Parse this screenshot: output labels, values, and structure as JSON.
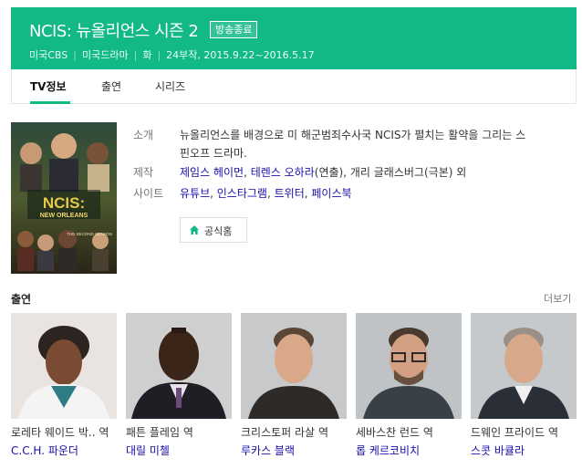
{
  "header": {
    "title": "NCIS: 뉴올리언스 시즌 2",
    "badge": "방송종료",
    "meta": [
      "미국CBS",
      "미국드라마",
      "화",
      "24부작, 2015.9.22~2016.5.17"
    ]
  },
  "tabs": [
    {
      "label": "TV정보",
      "active": true
    },
    {
      "label": "출연",
      "active": false
    },
    {
      "label": "시리즈",
      "active": false
    }
  ],
  "poster": {
    "logo_text": "NCIS:",
    "logo_sub": "NEW ORLEANS",
    "season_text": "THE SECOND SEASON"
  },
  "info": {
    "synopsis_label": "소개",
    "synopsis_line1": "뉴올리언스를 배경으로 미 해군범죄수사국 NCIS가 펼치는 활약을 그리는 스",
    "synopsis_line2": "핀오프 드라마.",
    "producer_label": "제작",
    "producer_links": [
      "제임스 헤이먼",
      "테렌스 오하라"
    ],
    "producer_note1": "(연출)",
    "producer_plain": "개리 글래스버그",
    "producer_note2": "(극본)",
    "producer_suffix": "외",
    "site_label": "사이트",
    "site_links": [
      "유튜브",
      "인스타그램",
      "트위터",
      "페이스북"
    ],
    "home_button": "공식홈"
  },
  "cast": {
    "title": "출연",
    "more": "더보기",
    "members": [
      {
        "role": "로레타 웨이드 박..",
        "role_suffix": "역",
        "actor": "C.C.H. 파운더"
      },
      {
        "role": "패튼 플레임",
        "role_suffix": "역",
        "actor": "대릴 미첼"
      },
      {
        "role": "크리스토퍼 라살",
        "role_suffix": "역",
        "actor": "루카스 블랙"
      },
      {
        "role": "세바스찬 런드",
        "role_suffix": "역",
        "actor": "롭 케르코비치"
      },
      {
        "role": "드웨인 프라이드",
        "role_suffix": "역",
        "actor": "스콧 바큘라"
      }
    ]
  },
  "colors": {
    "brand": "#12b886",
    "link": "#1a0dab"
  }
}
